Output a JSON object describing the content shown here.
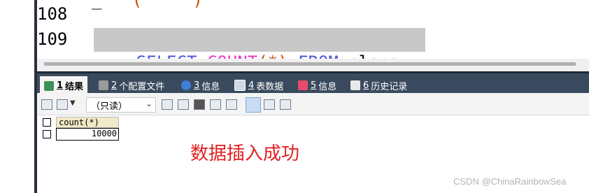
{
  "editor": {
    "lines": [
      {
        "number": "108"
      },
      {
        "number": "109",
        "tokens": [
          {
            "text": "SELECT",
            "kind": "keyword"
          },
          {
            "text": " ",
            "kind": "space"
          },
          {
            "text": "COUNT",
            "kind": "function"
          },
          {
            "text": "(*)",
            "kind": "punct"
          },
          {
            "text": " ",
            "kind": "space"
          },
          {
            "text": "FROM",
            "kind": "keyword"
          },
          {
            "text": " ",
            "kind": "space"
          },
          {
            "text": "class",
            "kind": "ident"
          },
          {
            "text": ";",
            "kind": "punct"
          }
        ]
      }
    ],
    "colors": {
      "keyword": "#4b57d6",
      "function": "#e83cc2",
      "punct": "#d14a00",
      "selection": "#c8c8c8"
    }
  },
  "tabs": [
    {
      "num": "1",
      "label": "结果",
      "active": true,
      "icon": "result-grid-icon"
    },
    {
      "num": "2",
      "label": "个配置文件",
      "icon": "profile-icon"
    },
    {
      "num": "3",
      "label": "信息",
      "icon": "info-icon"
    },
    {
      "num": "4",
      "label": "表数据",
      "icon": "table-data-icon"
    },
    {
      "num": "5",
      "label": "信息",
      "icon": "info-icon"
    },
    {
      "num": "6",
      "label": "历史记录",
      "icon": "history-icon"
    }
  ],
  "toolbar": {
    "mode_dropdown": "（只读）"
  },
  "results": {
    "columns": [
      "count(*)"
    ],
    "rows": [
      [
        "10000"
      ]
    ]
  },
  "annotation": "数据插入成功",
  "watermark": "CSDN @ChinaRainbowSea"
}
